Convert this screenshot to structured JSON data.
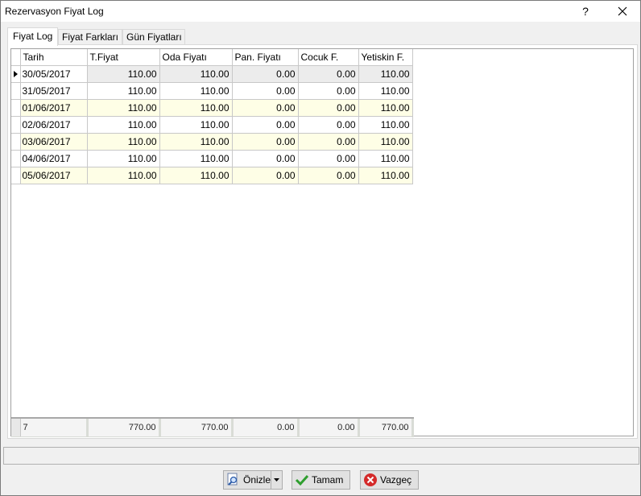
{
  "window": {
    "title": "Rezervasyon Fiyat Log",
    "help_label": "?"
  },
  "tabs": [
    "Fiyat Log",
    "Fiyat Farkları",
    "Gün Fiyatları"
  ],
  "grid": {
    "columns": [
      "Tarih",
      "T.Fiyat",
      "Oda Fiyatı",
      "Pan. Fiyatı",
      "Cocuk F.",
      "Yetiskin F."
    ],
    "rows": [
      [
        "30/05/2017",
        "110.00",
        "110.00",
        "0.00",
        "0.00",
        "110.00"
      ],
      [
        "31/05/2017",
        "110.00",
        "110.00",
        "0.00",
        "0.00",
        "110.00"
      ],
      [
        "01/06/2017",
        "110.00",
        "110.00",
        "0.00",
        "0.00",
        "110.00"
      ],
      [
        "02/06/2017",
        "110.00",
        "110.00",
        "0.00",
        "0.00",
        "110.00"
      ],
      [
        "03/06/2017",
        "110.00",
        "110.00",
        "0.00",
        "0.00",
        "110.00"
      ],
      [
        "04/06/2017",
        "110.00",
        "110.00",
        "0.00",
        "0.00",
        "110.00"
      ],
      [
        "05/06/2017",
        "110.00",
        "110.00",
        "0.00",
        "0.00",
        "110.00"
      ]
    ],
    "footer": [
      "7",
      "770.00",
      "770.00",
      "0.00",
      "0.00",
      "770.00"
    ]
  },
  "buttons": {
    "preview": "Önizle",
    "ok": "Tamam",
    "cancel": "Vazgeç"
  },
  "icons": {
    "preview": "preview-magnifier-icon",
    "ok": "checkmark-icon",
    "cancel": "cancel-x-icon"
  },
  "colors": {
    "alt_row": "#fefee6",
    "ok_green": "#2e9e2e",
    "cancel_red": "#d42a2a"
  }
}
